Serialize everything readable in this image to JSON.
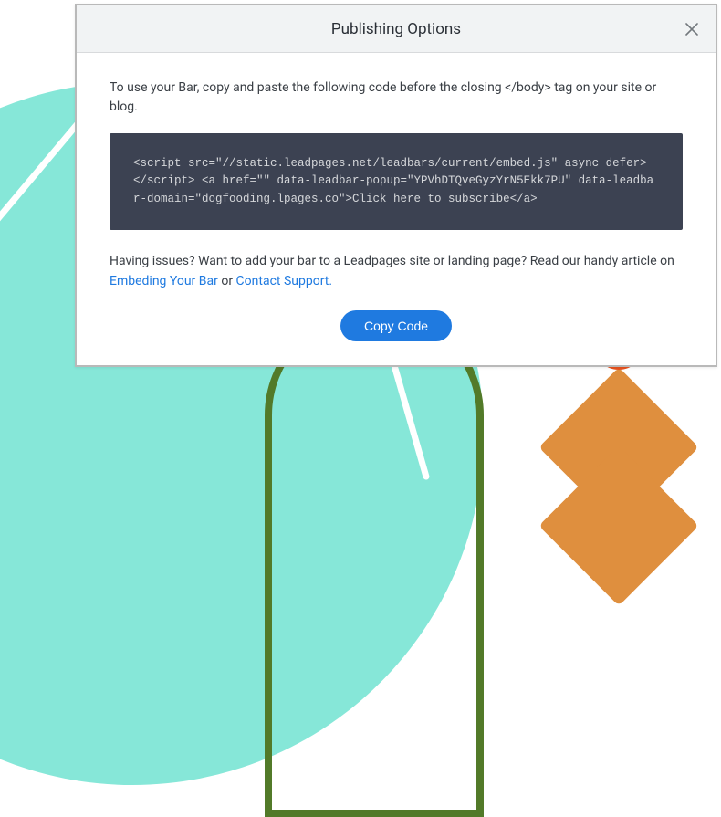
{
  "modal": {
    "title": "Publishing Options",
    "intro": "To use your Bar, copy and paste the following code before the closing </body> tag on your site or blog.",
    "code": "<script src=\"//static.leadpages.net/leadbars/current/embed.js\" async defer></script> <a href=\"\" data-leadbar-popup=\"YPVhDTQveGyzYrN5Ekk7PU\" data-leadbar-domain=\"dogfooding.lpages.co\">Click here to subscribe</a>",
    "help_prefix": "Having issues? Want to add your bar to a Leadpages site or landing page? Read our handy article on ",
    "help_link1": "Embeding Your Bar",
    "help_mid": " or ",
    "help_link2": "Contact Support.",
    "copy_button": "Copy Code"
  }
}
